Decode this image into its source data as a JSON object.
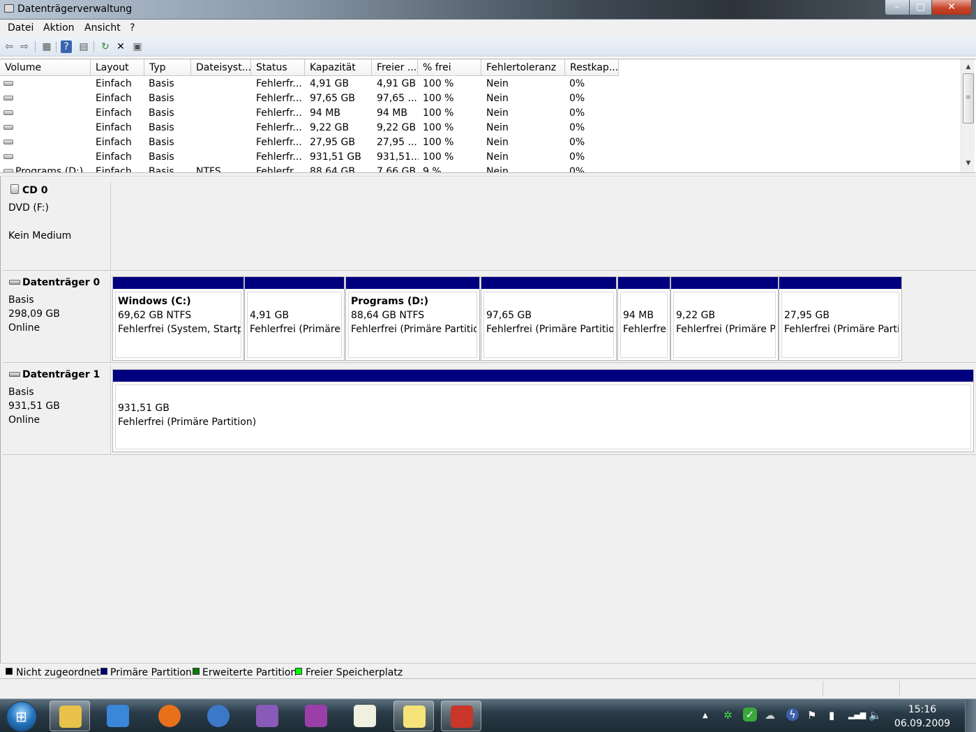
{
  "window": {
    "title": "Datenträgerverwaltung",
    "minimize": "–",
    "maximize": "▢",
    "close": "✕"
  },
  "menu": [
    "Datei",
    "Aktion",
    "Ansicht",
    "?"
  ],
  "toolbar": {
    "back": "⇦",
    "forward": "⇨",
    "properties": "▦",
    "help": "?",
    "console": "▤",
    "refresh": "↻",
    "delete": "✕",
    "settings": "▣"
  },
  "volume_table": {
    "columns": [
      "Volume",
      "Layout",
      "Typ",
      "Dateisyst...",
      "Status",
      "Kapazität",
      "Freier ...",
      "% frei",
      "Fehlertoleranz",
      "Restkap..."
    ],
    "rows": [
      [
        "",
        "Einfach",
        "Basis",
        "",
        "Fehlerfr...",
        "4,91 GB",
        "4,91 GB",
        "100 %",
        "Nein",
        "0%"
      ],
      [
        "",
        "Einfach",
        "Basis",
        "",
        "Fehlerfr...",
        "97,65 GB",
        "97,65 ...",
        "100 %",
        "Nein",
        "0%"
      ],
      [
        "",
        "Einfach",
        "Basis",
        "",
        "Fehlerfr...",
        "94 MB",
        "94 MB",
        "100 %",
        "Nein",
        "0%"
      ],
      [
        "",
        "Einfach",
        "Basis",
        "",
        "Fehlerfr...",
        "9,22 GB",
        "9,22 GB",
        "100 %",
        "Nein",
        "0%"
      ],
      [
        "",
        "Einfach",
        "Basis",
        "",
        "Fehlerfr...",
        "27,95 GB",
        "27,95 ...",
        "100 %",
        "Nein",
        "0%"
      ],
      [
        "",
        "Einfach",
        "Basis",
        "",
        "Fehlerfr...",
        "931,51 GB",
        "931,51...",
        "100 %",
        "Nein",
        "0%"
      ],
      [
        "Programs (D:)",
        "Einfach",
        "Basis",
        "NTFS",
        "Fehlerfr...",
        "88,64 GB",
        "7,66 GB",
        "9 %",
        "Nein",
        "0%"
      ]
    ]
  },
  "cd0": {
    "name": "CD 0",
    "type": "DVD (F:)",
    "media": "Kein Medium"
  },
  "disk0": {
    "name": "Datenträger 0",
    "type": "Basis",
    "size": "298,09 GB",
    "state": "Online",
    "partitions": [
      {
        "title": "Windows  (C:)",
        "size": "69,62 GB NTFS",
        "status": "Fehlerfrei (System, Startpa"
      },
      {
        "title": "",
        "size": "4,91 GB",
        "status": "Fehlerfrei (Primäre I"
      },
      {
        "title": "Programs  (D:)",
        "size": "88,64 GB NTFS",
        "status": "Fehlerfrei (Primäre Partition"
      },
      {
        "title": "",
        "size": "97,65 GB",
        "status": "Fehlerfrei (Primäre Partition"
      },
      {
        "title": "",
        "size": "94 MB",
        "status": "Fehlerfrei"
      },
      {
        "title": "",
        "size": "9,22 GB",
        "status": "Fehlerfrei (Primäre Pa"
      },
      {
        "title": "",
        "size": "27,95 GB",
        "status": "Fehlerfrei (Primäre Partit"
      }
    ]
  },
  "disk1": {
    "name": "Datenträger 1",
    "type": "Basis",
    "size": "931,51 GB",
    "state": "Online",
    "partitions": [
      {
        "title": "",
        "size": "931,51 GB",
        "status": "Fehlerfrei (Primäre Partition)"
      }
    ]
  },
  "legend": [
    {
      "label": "Nicht zugeordnet",
      "color": "#000000"
    },
    {
      "label": "Primäre Partition",
      "color": "#00007f"
    },
    {
      "label": "Erweiterte Partition",
      "color": "#007f00"
    },
    {
      "label": "Freier Speicherplatz",
      "color": "#00ff00"
    }
  ],
  "taskbar": {
    "start": "⊞",
    "apps": [
      "explorer-icon",
      "media-player-icon",
      "firefox-icon",
      "thunderbird-icon",
      "pidgin-icon",
      "onenote-icon",
      "notepad-icon",
      "sticky-notes-icon",
      "computer-management-icon"
    ],
    "tray": {
      "arrow": "▲",
      "network": "✲",
      "security": "✓",
      "sync": "☁",
      "hp": "ϟ",
      "flag": "⚑",
      "battery": "▮",
      "signal": "▂▄▆",
      "volume": "🔈"
    },
    "time": "15:16",
    "date": "06.09.2009"
  }
}
